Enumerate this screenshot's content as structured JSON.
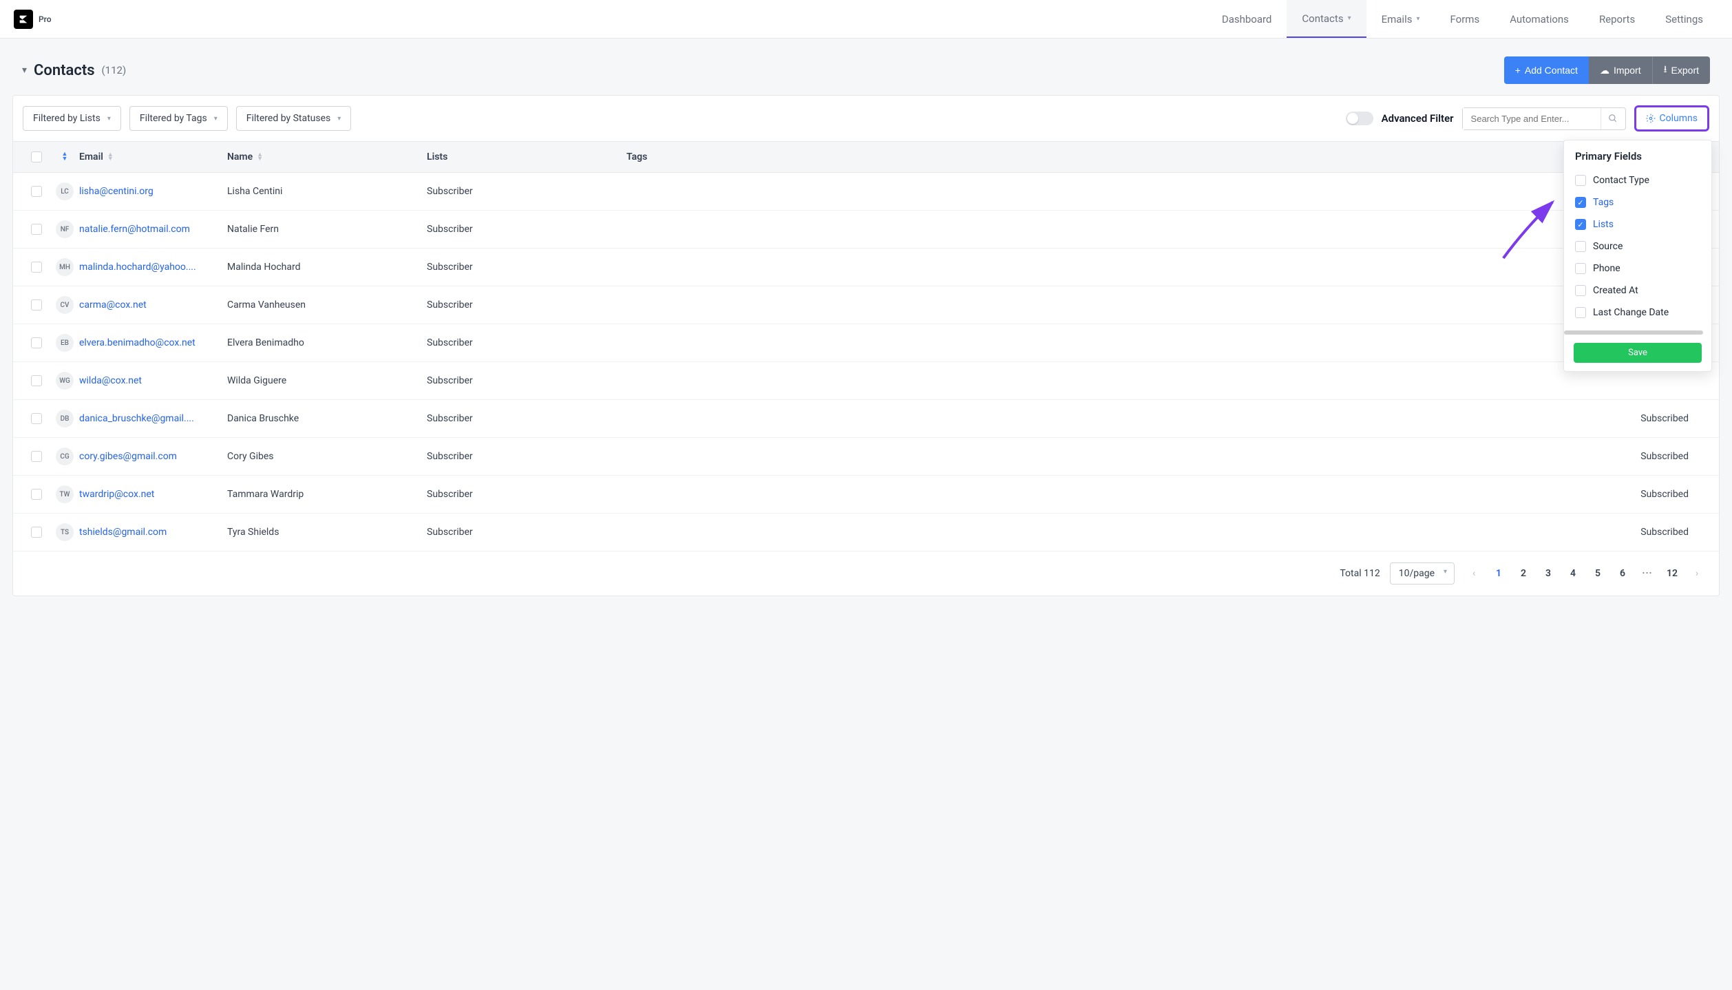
{
  "logo_label": "Pro",
  "nav": [
    {
      "label": "Dashboard",
      "dropdown": false,
      "active": false
    },
    {
      "label": "Contacts",
      "dropdown": true,
      "active": true
    },
    {
      "label": "Emails",
      "dropdown": true,
      "active": false
    },
    {
      "label": "Forms",
      "dropdown": false,
      "active": false
    },
    {
      "label": "Automations",
      "dropdown": false,
      "active": false
    },
    {
      "label": "Reports",
      "dropdown": false,
      "active": false
    },
    {
      "label": "Settings",
      "dropdown": false,
      "active": false
    }
  ],
  "page_title": "Contacts",
  "page_count": "(112)",
  "actions": {
    "add": "Add Contact",
    "import": "Import",
    "export": "Export"
  },
  "filters": {
    "lists": "Filtered by Lists",
    "tags": "Filtered by Tags",
    "statuses": "Filtered by Statuses"
  },
  "advanced_filter_label": "Advanced Filter",
  "search_placeholder": "Search Type and Enter...",
  "columns_btn": "Columns",
  "table_headers": {
    "email": "Email",
    "name": "Name",
    "lists": "Lists",
    "tags": "Tags"
  },
  "rows": [
    {
      "initials": "LC",
      "email": "lisha@centini.org",
      "name": "Lisha Centini",
      "lists": "Subscriber",
      "tags": "",
      "status": ""
    },
    {
      "initials": "NF",
      "email": "natalie.fern@hotmail.com",
      "name": "Natalie Fern",
      "lists": "Subscriber",
      "tags": "",
      "status": ""
    },
    {
      "initials": "MH",
      "email": "malinda.hochard@yahoo....",
      "name": "Malinda Hochard",
      "lists": "Subscriber",
      "tags": "",
      "status": ""
    },
    {
      "initials": "CV",
      "email": "carma@cox.net",
      "name": "Carma Vanheusen",
      "lists": "Subscriber",
      "tags": "",
      "status": ""
    },
    {
      "initials": "EB",
      "email": "elvera.benimadho@cox.net",
      "name": "Elvera Benimadho",
      "lists": "Subscriber",
      "tags": "",
      "status": ""
    },
    {
      "initials": "WG",
      "email": "wilda@cox.net",
      "name": "Wilda Giguere",
      "lists": "Subscriber",
      "tags": "",
      "status": ""
    },
    {
      "initials": "DB",
      "email": "danica_bruschke@gmail....",
      "name": "Danica Bruschke",
      "lists": "Subscriber",
      "tags": "",
      "status": "Subscribed"
    },
    {
      "initials": "CG",
      "email": "cory.gibes@gmail.com",
      "name": "Cory Gibes",
      "lists": "Subscriber",
      "tags": "",
      "status": "Subscribed"
    },
    {
      "initials": "TW",
      "email": "twardrip@cox.net",
      "name": "Tammara Wardrip",
      "lists": "Subscriber",
      "tags": "",
      "status": "Subscribed"
    },
    {
      "initials": "TS",
      "email": "tshields@gmail.com",
      "name": "Tyra Shields",
      "lists": "Subscriber",
      "tags": "",
      "status": "Subscribed"
    }
  ],
  "columns_panel": {
    "title": "Primary Fields",
    "items": [
      {
        "label": "Contact Type",
        "checked": false
      },
      {
        "label": "Tags",
        "checked": true
      },
      {
        "label": "Lists",
        "checked": true
      },
      {
        "label": "Source",
        "checked": false
      },
      {
        "label": "Phone",
        "checked": false
      },
      {
        "label": "Created At",
        "checked": false
      },
      {
        "label": "Last Change Date",
        "checked": false
      }
    ],
    "save": "Save"
  },
  "footer": {
    "total": "Total 112",
    "page_size": "10/page",
    "pages": [
      "1",
      "2",
      "3",
      "4",
      "5",
      "6",
      "···",
      "12"
    ]
  }
}
